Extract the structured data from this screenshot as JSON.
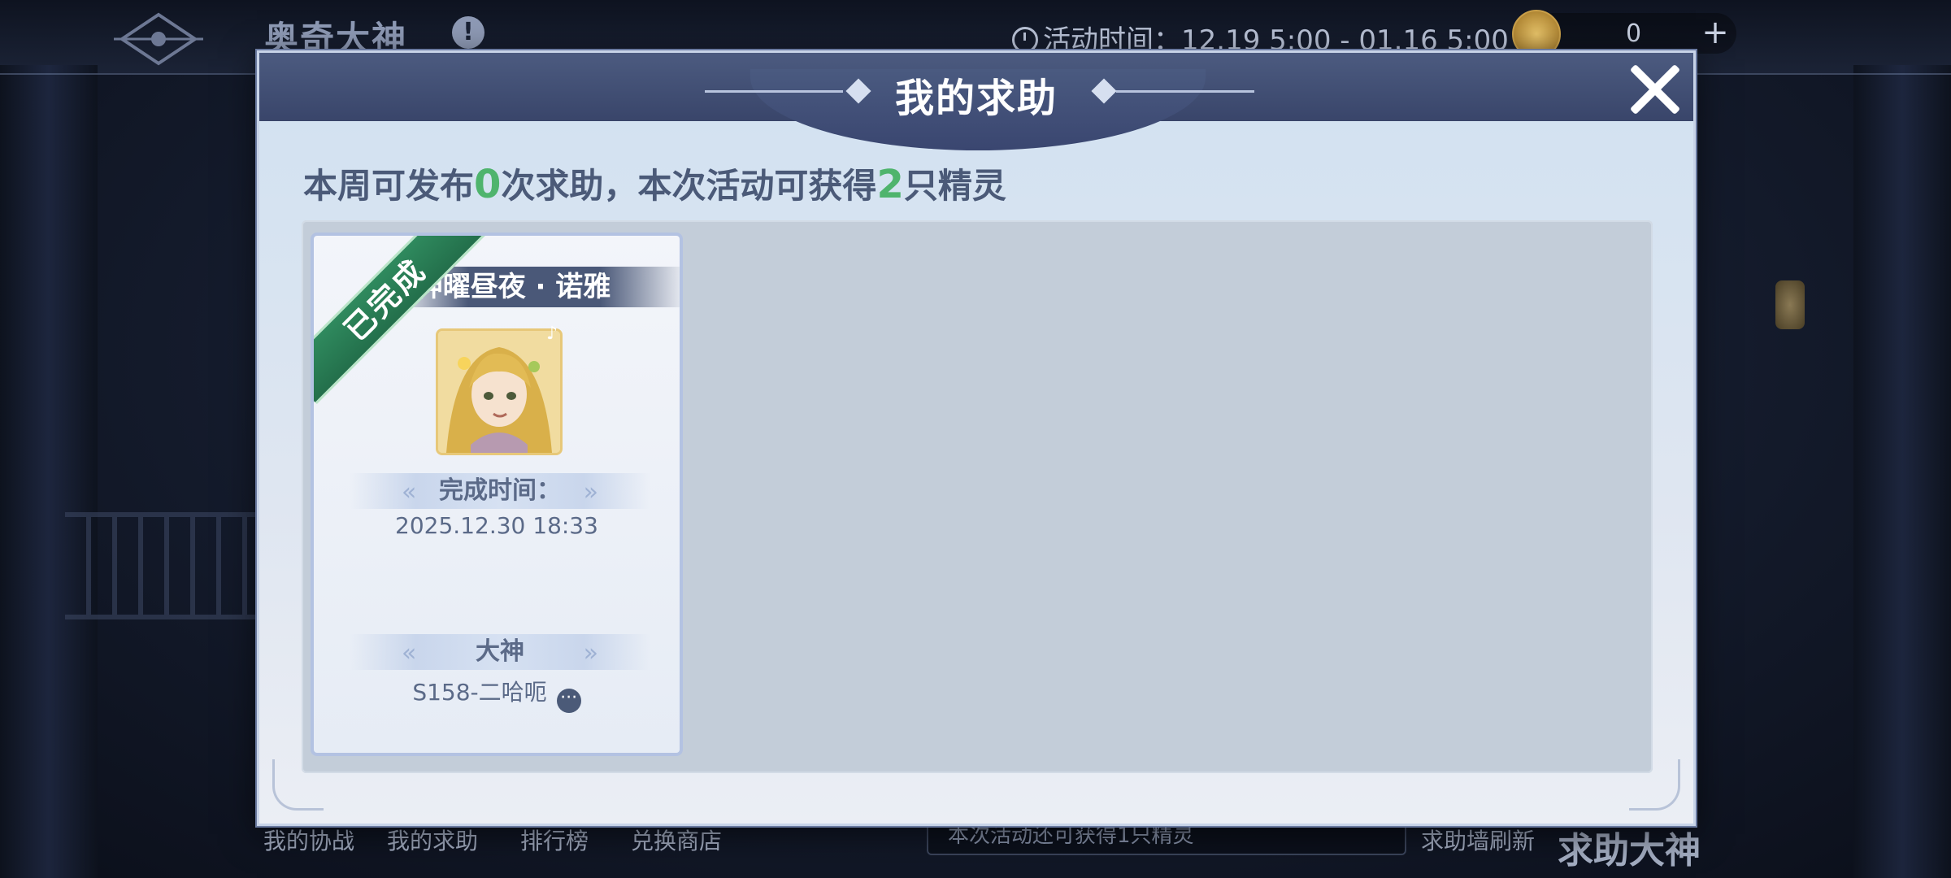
{
  "topbar": {
    "title": "奥奇大神",
    "info_icon": "!",
    "activity_time": "活动时间：12.19 5:00 - 01.16 5:00",
    "currency_value": "0",
    "plus_icon": "+"
  },
  "dialog": {
    "title": "我的求助",
    "summary": {
      "part1": "本周可发布",
      "num1": "0",
      "part2": "次求助，本次活动可获得",
      "num2": "2",
      "part3": "只精灵"
    },
    "cards": [
      {
        "status": "已完成",
        "name": "神曜昼夜 · 诺雅",
        "complete_label": "完成时间：",
        "complete_time": "2025.12.30 18:33",
        "helper_label": "大神",
        "helper_name": "S158-二哈呃"
      }
    ]
  },
  "bottombar": {
    "items": [
      "我的协战",
      "我的求助",
      "排行榜",
      "兑换商店"
    ],
    "notice": "本次活动还可获得1只精灵",
    "refresh_label": "求助墙刷新",
    "big_title": "求助大神"
  },
  "colors": {
    "accent_green": "#4fb46d",
    "header_navy": "#3f4c72",
    "ribbon_green": "#2f8a5e"
  },
  "icons": [
    "logo-icon",
    "info-icon",
    "clock-icon",
    "coin-icon",
    "plus-icon",
    "close-icon",
    "music-note-icon",
    "more-icon"
  ]
}
